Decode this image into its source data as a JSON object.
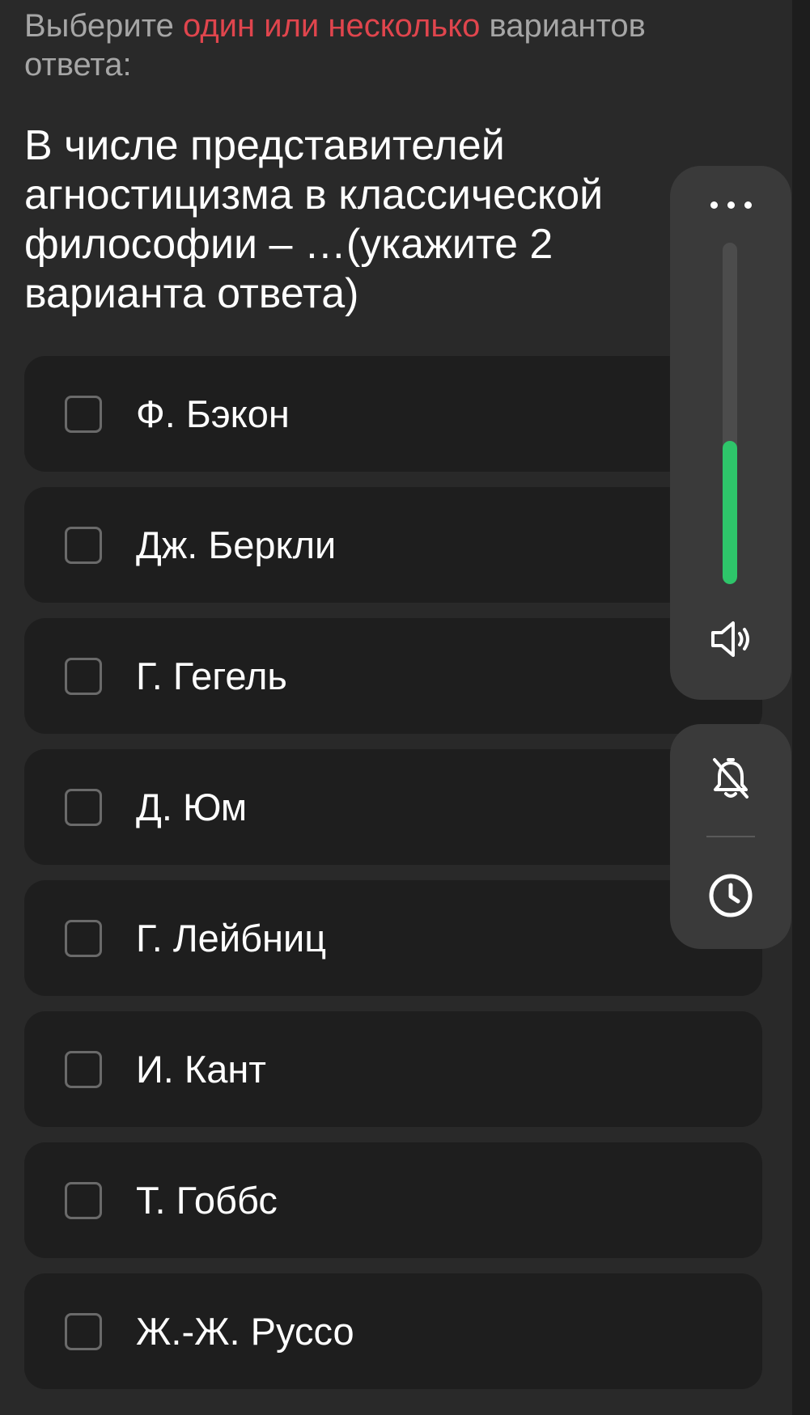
{
  "instruction": {
    "prefix": "Выберите ",
    "highlight": "один или несколько",
    "suffix": " вариантов ответа:"
  },
  "question": "В числе представителей агностицизма в классической философии – …(укажите 2 варианта ответа)",
  "options": [
    {
      "label": "Ф. Бэкон",
      "checked": false
    },
    {
      "label": "Дж. Беркли",
      "checked": false
    },
    {
      "label": "Г. Гегель",
      "checked": false
    },
    {
      "label": "Д. Юм",
      "checked": false
    },
    {
      "label": "Г. Лейбниц",
      "checked": false
    },
    {
      "label": "И. Кант",
      "checked": false
    },
    {
      "label": "Т. Гоббс",
      "checked": false
    },
    {
      "label": "Ж.-Ж. Руссо",
      "checked": false
    }
  ],
  "side_panel": {
    "more_icon": "more-horizontal-icon",
    "volume_level": 0.42,
    "speaker_icon": "speaker-icon",
    "bell_icon": "bell-off-icon",
    "clock_icon": "clock-icon"
  },
  "colors": {
    "background": "#292929",
    "card": "#1e1e1e",
    "accent_red": "#e0454d",
    "volume_green": "#2ec56a",
    "panel": "#3a3a3a"
  }
}
